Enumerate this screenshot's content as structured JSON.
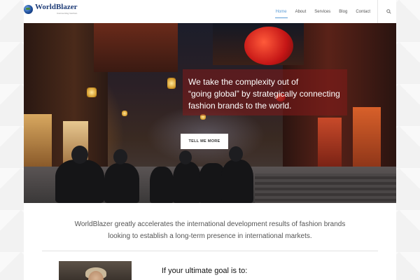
{
  "header": {
    "logo_name": "WorldBlazer",
    "logo_tagline": "Connecting fashion",
    "nav": [
      {
        "label": "Home",
        "active": true
      },
      {
        "label": "About",
        "active": false
      },
      {
        "label": "Services",
        "active": false
      },
      {
        "label": "Blog",
        "active": false
      },
      {
        "label": "Contact",
        "active": false
      }
    ],
    "search_icon": "search-icon",
    "accent_color": "#5a9bd5"
  },
  "hero": {
    "lines": [
      "We take the complexity out of",
      "“going global” by strategically connecting",
      "fashion brands to the world."
    ],
    "button_label": "TELL ME MORE",
    "overlay_color": "#82191980"
  },
  "intro": {
    "lines": [
      "WorldBlazer greatly accelerates the international development results of fashion brands",
      "looking to establish a long-term presence in international markets."
    ]
  },
  "goal_heading": "If your ultimate goal is to:"
}
